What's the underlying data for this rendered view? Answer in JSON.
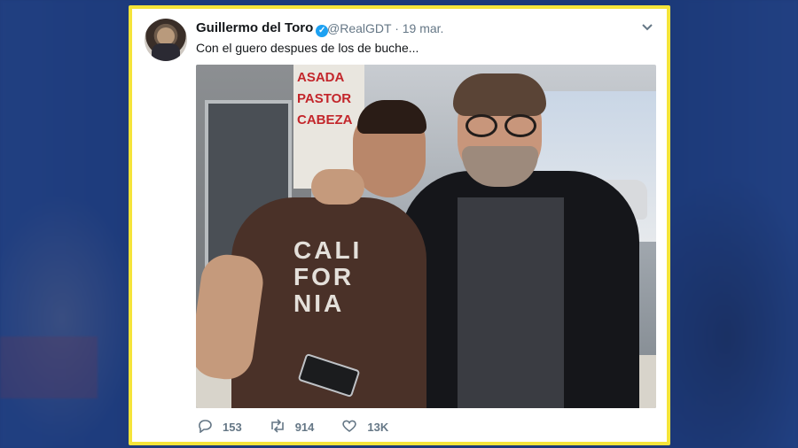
{
  "tweet": {
    "author_name": "Guillermo del Toro",
    "handle_date": "@RealGDT · 19 mar.",
    "text": "Con el guero despues de los de buche...",
    "icons": {
      "verified": "verified-badge-icon",
      "menu": "chevron-down-icon"
    }
  },
  "photo": {
    "menu_sign": [
      "ASADA",
      "PASTOR",
      "CABEZA"
    ],
    "shirt_print": [
      "CALI",
      "FOR",
      "NIA"
    ]
  },
  "actions": {
    "replies": "153",
    "retweets": "914",
    "likes": "13K"
  },
  "colors": {
    "card_border": "#f5e43a",
    "verified": "#1da1f2",
    "muted_text": "#657786"
  }
}
